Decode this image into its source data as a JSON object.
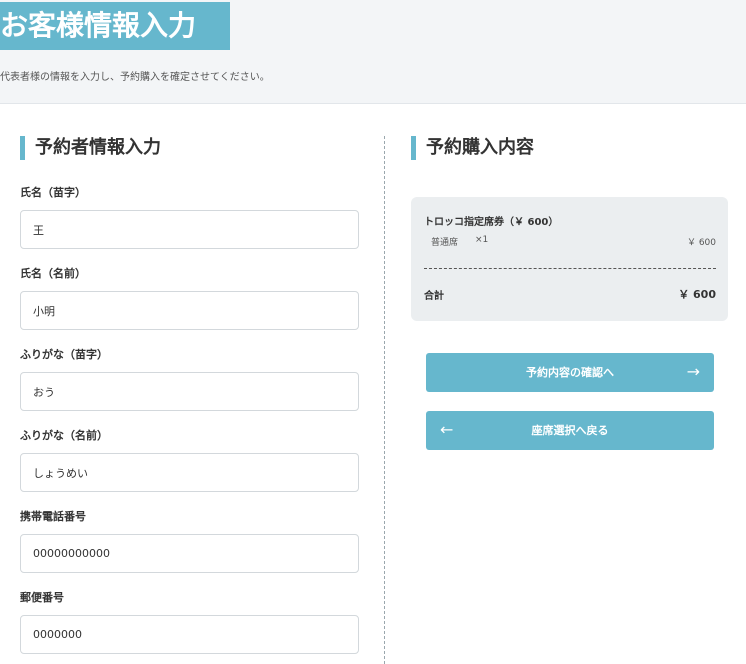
{
  "header": {
    "title": "お客様情報入力",
    "description": "代表者様の情報を入力し、予約購入を確定させてください。"
  },
  "form": {
    "section_title": "予約者情報入力",
    "fields": [
      {
        "label": "氏名（苗字）",
        "value": "王"
      },
      {
        "label": "氏名（名前）",
        "value": "小明"
      },
      {
        "label": "ふりがな（苗字）",
        "value": "おう"
      },
      {
        "label": "ふりがな（名前）",
        "value": "しょうめい"
      },
      {
        "label": "携帯電話番号",
        "value": "00000000000"
      },
      {
        "label": "郵便番号",
        "value": "0000000"
      }
    ]
  },
  "summary": {
    "section_title": "予約購入内容",
    "item_title": "トロッコ指定席券（￥ 600）",
    "item_name": "普通席",
    "item_qty": "×1",
    "item_price": "￥ 600",
    "total_label": "合計",
    "total_amount": "￥ 600"
  },
  "buttons": {
    "confirm_label": "予約内容の確認へ",
    "back_label": "座席選択へ戻る",
    "confirm_icon": "arrow-right-icon",
    "back_icon": "arrow-left-icon"
  },
  "colors": {
    "accent": "#66b7cd",
    "header_bg": "#f3f5f7",
    "card_bg": "#ebeef0"
  }
}
